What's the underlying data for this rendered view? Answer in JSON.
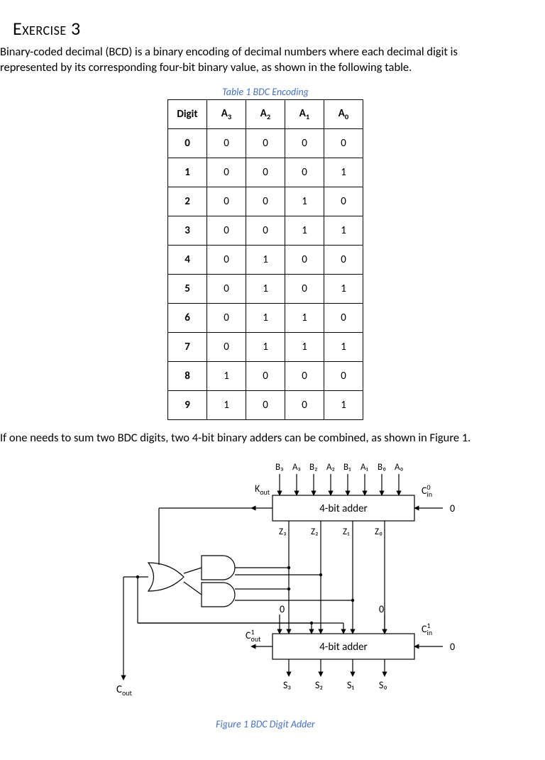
{
  "title": "Exercise 3",
  "p1": "Binary-coded decimal (BCD) is a binary encoding of decimal numbers where each decimal digit is represented by its corresponding four-bit binary value, as shown in the following table.",
  "table_caption": "Table 1 BDC Encoding",
  "headers": {
    "digit": "Digit",
    "a3": "A",
    "a2": "A",
    "a1": "A",
    "a0": "A"
  },
  "sub": {
    "a3": "3",
    "a2": "2",
    "a1": "1",
    "a0": "0"
  },
  "rows": [
    {
      "d": "0",
      "a3": "0",
      "a2": "0",
      "a1": "0",
      "a0": "0"
    },
    {
      "d": "1",
      "a3": "0",
      "a2": "0",
      "a1": "0",
      "a0": "1"
    },
    {
      "d": "2",
      "a3": "0",
      "a2": "0",
      "a1": "1",
      "a0": "0"
    },
    {
      "d": "3",
      "a3": "0",
      "a2": "0",
      "a1": "1",
      "a0": "1"
    },
    {
      "d": "4",
      "a3": "0",
      "a2": "1",
      "a1": "0",
      "a0": "0"
    },
    {
      "d": "5",
      "a3": "0",
      "a2": "1",
      "a1": "0",
      "a0": "1"
    },
    {
      "d": "6",
      "a3": "0",
      "a2": "1",
      "a1": "1",
      "a0": "0"
    },
    {
      "d": "7",
      "a3": "0",
      "a2": "1",
      "a1": "1",
      "a0": "1"
    },
    {
      "d": "8",
      "a3": "1",
      "a2": "0",
      "a1": "0",
      "a0": "0"
    },
    {
      "d": "9",
      "a3": "1",
      "a2": "0",
      "a1": "0",
      "a0": "1"
    }
  ],
  "p2": "If one needs to sum two BDC digits, two 4-bit binary adders can be combined, as shown in Figure 1.",
  "figure_caption": "Figure 1 BDC Digit Adder",
  "diagram": {
    "top_inputs": [
      "B₃",
      "A₃",
      "B₂",
      "A₂",
      "B₁",
      "A₁",
      "B₀",
      "A₀"
    ],
    "adder_label": "4-bit adder",
    "kout": "K",
    "kout_sub": "out",
    "cin0": "C",
    "cin0_sup": "0",
    "cin0_sub": "in",
    "cin1": "C",
    "cin1_sup": "1",
    "cin1_sub": "in",
    "cout1": "C",
    "cout1_sup": "1",
    "cout1_sub": "out",
    "cout": "C",
    "cout_sub": "out",
    "z": [
      "Z₃",
      "Z₂",
      "Z₁",
      "Z₀"
    ],
    "s": [
      "S₃",
      "S₂",
      "S₁",
      "S₀"
    ],
    "zero": "0"
  }
}
